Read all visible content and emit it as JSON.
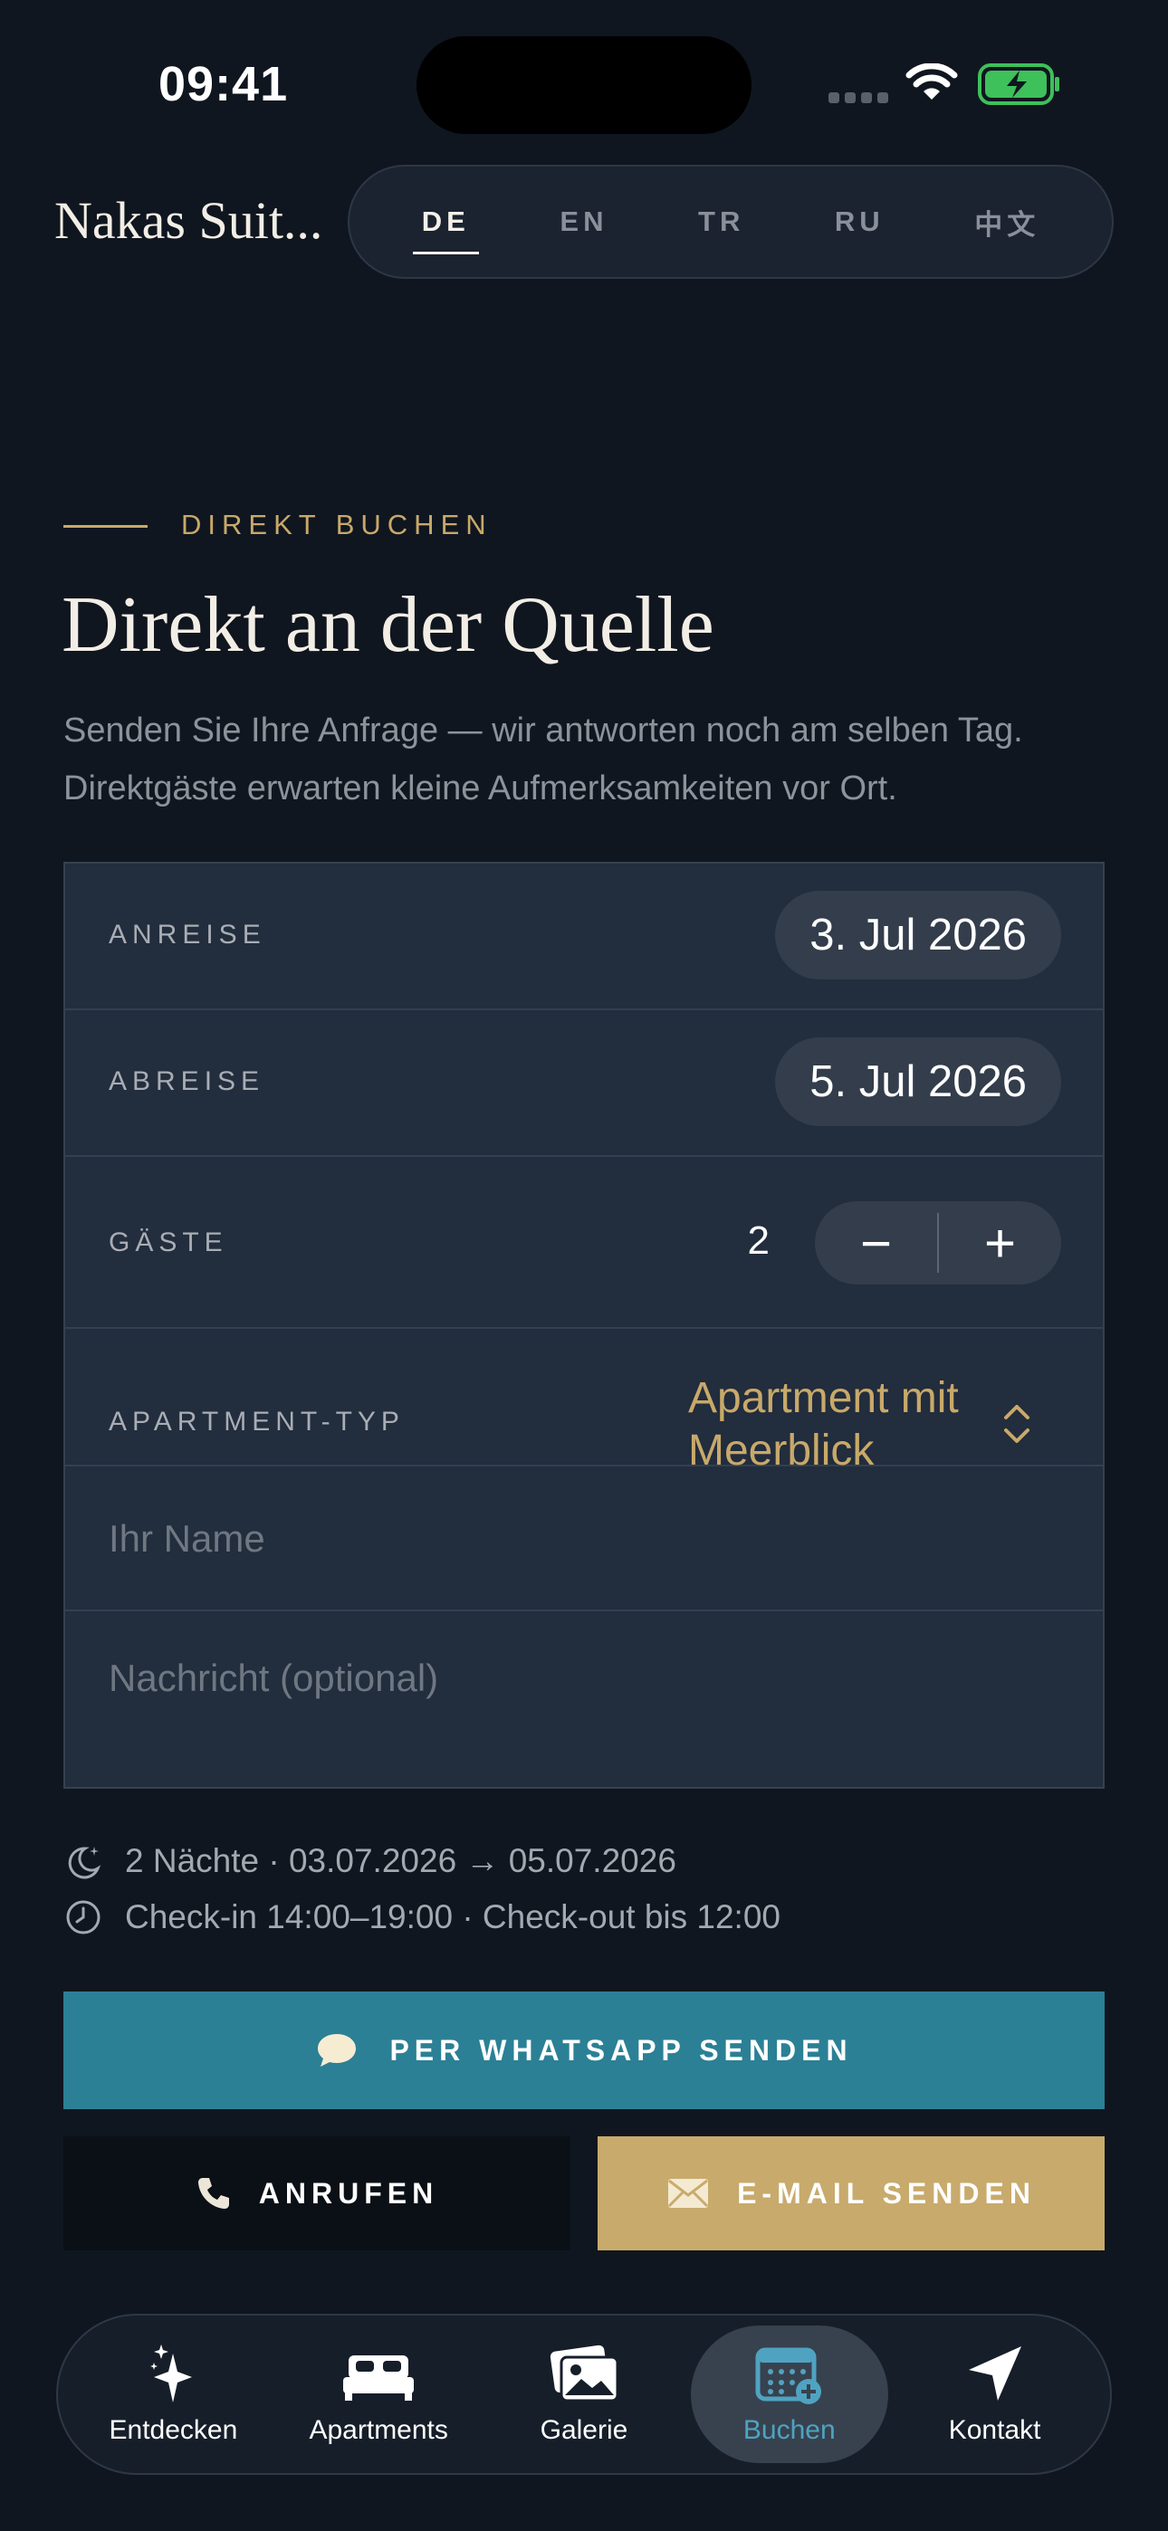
{
  "status": {
    "time": "09:41"
  },
  "header": {
    "brand": "Nakas Suit...",
    "languages": [
      "DE",
      "EN",
      "TR",
      "RU",
      "中文"
    ],
    "active_language": "DE"
  },
  "section": {
    "kicker": "DIREKT BUCHEN",
    "title": "Direkt an der Quelle",
    "intro": "Senden Sie Ihre Anfrage — wir antworten noch am selben Tag. Direktgäste erwarten kleine Aufmerksamkeiten vor Ort."
  },
  "form": {
    "arrival_label": "ANREISE",
    "arrival_value": "3. Jul 2026",
    "departure_label": "ABREISE",
    "departure_value": "5. Jul 2026",
    "guests_label": "GÄSTE",
    "guests_value": "2",
    "minus": "−",
    "plus": "+",
    "apartment_label": "APARTMENT-TYP",
    "apartment_value": "Apartment mit Meerblick",
    "name_placeholder": "Ihr Name",
    "message_placeholder": "Nachricht (optional)"
  },
  "summary": {
    "nights": "2 Nächte · 03.07.2026 → 05.07.2026",
    "checkin": "Check-in 14:00–19:00 · Check-out bis 12:00"
  },
  "actions": {
    "whatsapp": "PER WHATSAPP SENDEN",
    "call": "ANRUFEN",
    "email": "E-MAIL SENDEN"
  },
  "tabbar": {
    "items": [
      {
        "label": "Entdecken",
        "icon": "sparkles-icon"
      },
      {
        "label": "Apartments",
        "icon": "bed-icon"
      },
      {
        "label": "Galerie",
        "icon": "photos-icon"
      },
      {
        "label": "Buchen",
        "icon": "calendar-add-icon"
      },
      {
        "label": "Kontakt",
        "icon": "location-arrow-icon"
      }
    ],
    "active": "Buchen"
  },
  "colors": {
    "background": "#10161f",
    "accent_gold": "#c8a96a",
    "whatsapp_teal": "#2b8095",
    "active_tab": "#4fa3c1"
  }
}
